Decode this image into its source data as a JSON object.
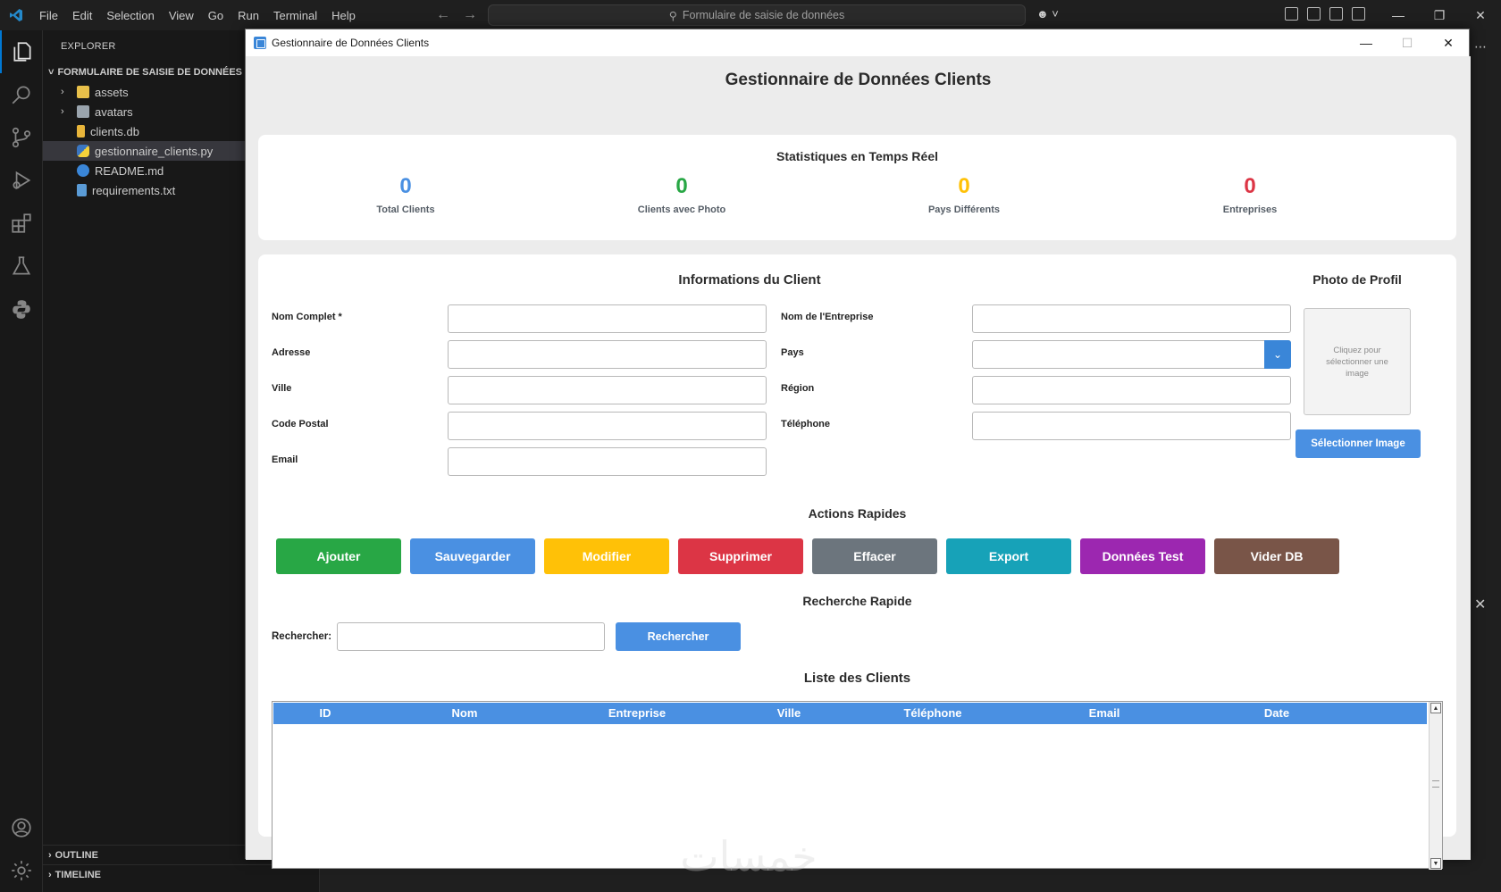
{
  "vscode": {
    "menu": [
      "File",
      "Edit",
      "Selection",
      "View",
      "Go",
      "Run",
      "Terminal",
      "Help"
    ],
    "search_placeholder": "Formulaire de saisie de données",
    "explorer_title": "EXPLORER",
    "folder_name": "FORMULAIRE DE SAISIE DE DONNÉES",
    "files": [
      {
        "name": "assets",
        "type": "folder",
        "icon": "folder-icon"
      },
      {
        "name": "avatars",
        "type": "folder",
        "icon": "folder-icon"
      },
      {
        "name": "clients.db",
        "type": "file",
        "icon": "database-icon"
      },
      {
        "name": "gestionnaire_clients.py",
        "type": "file",
        "icon": "python-icon",
        "selected": true
      },
      {
        "name": "README.md",
        "type": "file",
        "icon": "info-icon"
      },
      {
        "name": "requirements.txt",
        "type": "file",
        "icon": "text-file-icon"
      }
    ],
    "outline": "OUTLINE",
    "timeline": "TIMELINE",
    "colors": {
      "accent": "#0078d4",
      "background": "#1f1f1f",
      "sidebar": "#181818"
    }
  },
  "app": {
    "window_title": "Gestionnaire de Données Clients",
    "heading": "Gestionnaire de Données Clients",
    "stats": {
      "title": "Statistiques en Temps Réel",
      "items": [
        {
          "value": "0",
          "label": "Total Clients",
          "color": "#4a90e2"
        },
        {
          "value": "0",
          "label": "Clients avec Photo",
          "color": "#28a745"
        },
        {
          "value": "0",
          "label": "Pays Différents",
          "color": "#ffc107"
        },
        {
          "value": "0",
          "label": "Entreprises",
          "color": "#dc3545"
        }
      ]
    },
    "form": {
      "title": "Informations du Client",
      "left_fields": [
        {
          "label": "Nom Complet *",
          "value": ""
        },
        {
          "label": "Adresse",
          "value": ""
        },
        {
          "label": "Ville",
          "value": ""
        },
        {
          "label": "Code Postal",
          "value": ""
        },
        {
          "label": "Email",
          "value": ""
        }
      ],
      "right_fields": [
        {
          "label": "Nom de l'Entreprise",
          "value": ""
        },
        {
          "label": "Pays",
          "value": "",
          "type": "select"
        },
        {
          "label": "Région",
          "value": ""
        },
        {
          "label": "Téléphone",
          "value": ""
        }
      ]
    },
    "photo": {
      "title": "Photo de Profil",
      "placeholder": "Cliquez pour sélectionner une image",
      "button": "Sélectionner Image"
    },
    "actions": {
      "title": "Actions Rapides",
      "buttons": [
        {
          "label": "Ajouter",
          "color": "#28a745"
        },
        {
          "label": "Sauvegarder",
          "color": "#4a90e2"
        },
        {
          "label": "Modifier",
          "color": "#ffc107"
        },
        {
          "label": "Supprimer",
          "color": "#dc3545"
        },
        {
          "label": "Effacer",
          "color": "#6c757d"
        },
        {
          "label": "Export",
          "color": "#17a2b8"
        },
        {
          "label": "Données Test",
          "color": "#9c27b0"
        },
        {
          "label": "Vider DB",
          "color": "#795548"
        }
      ]
    },
    "search": {
      "title": "Recherche Rapide",
      "label": "Rechercher:",
      "value": "",
      "button": "Rechercher"
    },
    "table": {
      "title": "Liste des Clients",
      "columns": [
        "ID",
        "Nom",
        "Entreprise",
        "Ville",
        "Téléphone",
        "Email",
        "Date"
      ],
      "rows": []
    }
  }
}
